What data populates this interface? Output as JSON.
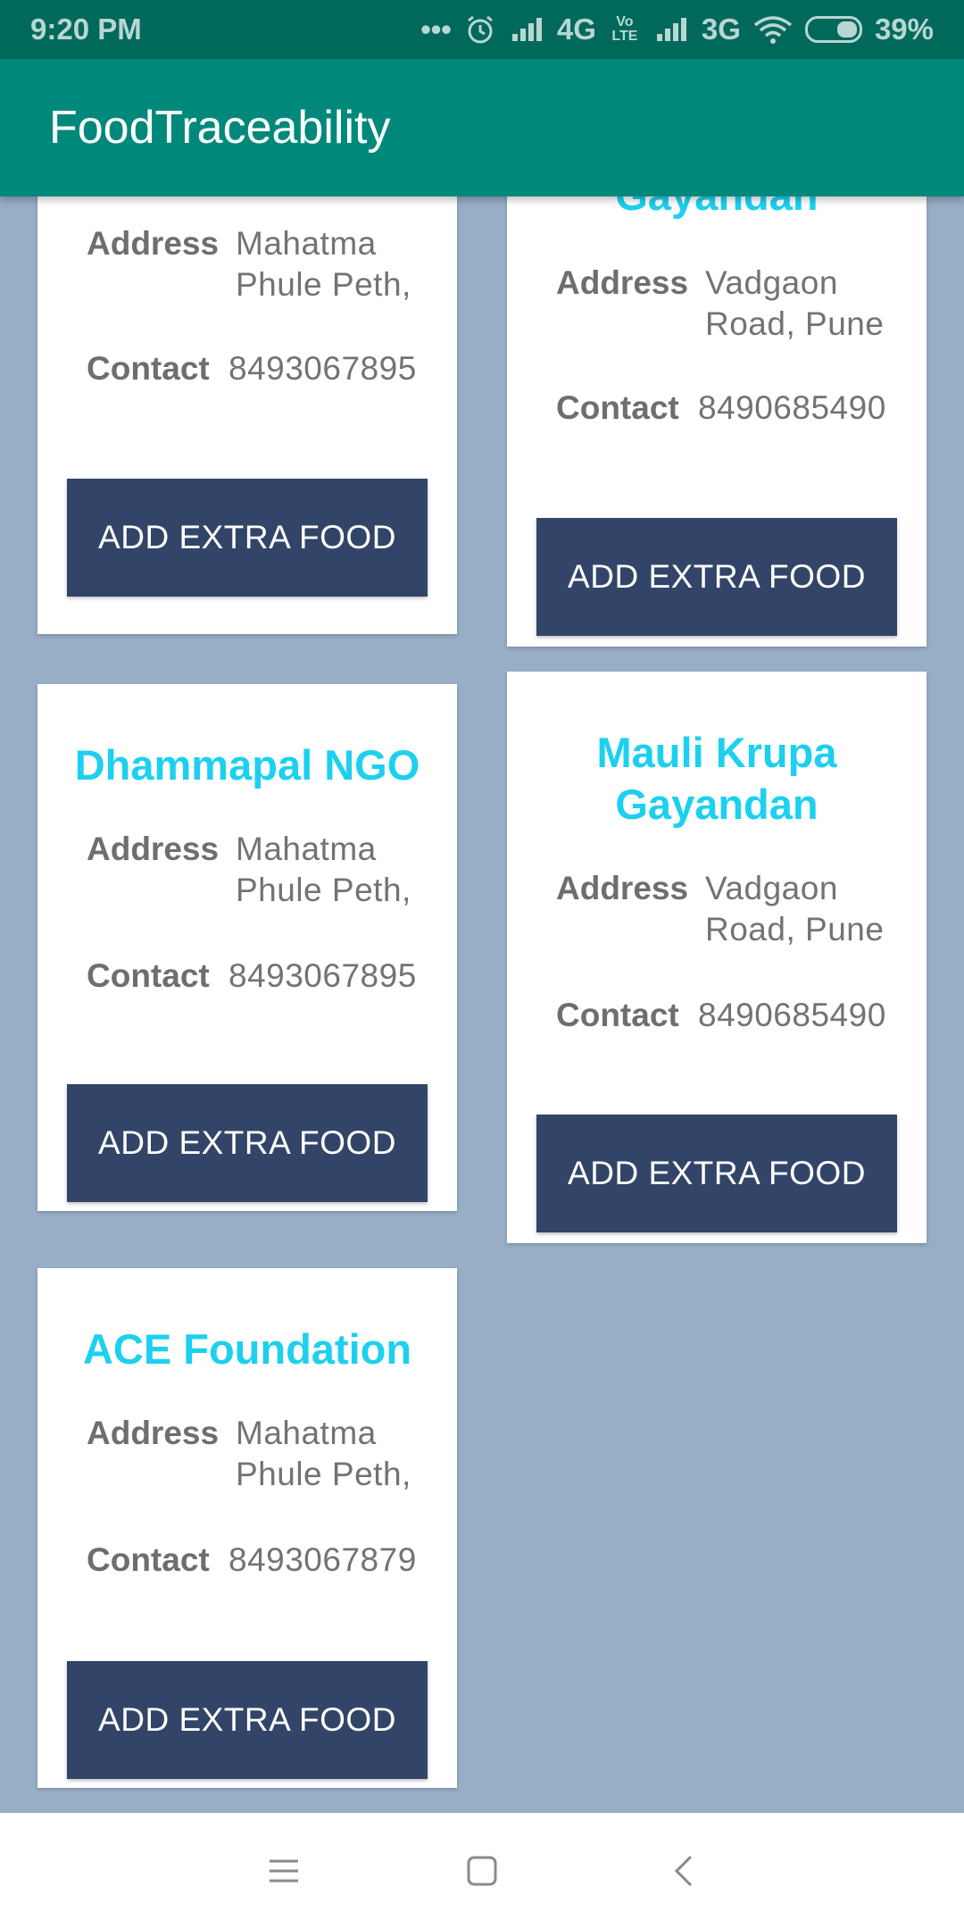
{
  "status": {
    "time": "9:20 PM",
    "dots": "•••",
    "network1": "4G",
    "volte": "Vo LTE",
    "network2": "3G",
    "battery": "39%"
  },
  "appbar": {
    "title": "FoodTraceability"
  },
  "cards": [
    {
      "title": "",
      "address_label": "Address",
      "address": "Mahatma Phule Peth,",
      "contact_label": "Contact",
      "contact": "8493067895",
      "button": "ADD EXTRA FOOD"
    },
    {
      "title": "Gayandan",
      "address_label": "Address",
      "address": "Vadgaon Road, Pune",
      "contact_label": "Contact",
      "contact": "8490685490",
      "button": "ADD EXTRA FOOD"
    },
    {
      "title": "Dhammapal NGO",
      "address_label": "Address",
      "address": "Mahatma Phule Peth,",
      "contact_label": "Contact",
      "contact": "8493067895",
      "button": "ADD EXTRA FOOD"
    },
    {
      "title": "Mauli Krupa Gayandan",
      "address_label": "Address",
      "address": "Vadgaon Road, Pune",
      "contact_label": "Contact",
      "contact": "8490685490",
      "button": "ADD EXTRA FOOD"
    },
    {
      "title": "ACE Foundation",
      "address_label": "Address",
      "address": "Mahatma Phule Peth,",
      "contact_label": "Contact",
      "contact": "8493067879",
      "button": "ADD EXTRA FOOD"
    }
  ],
  "colors": {
    "statusbar": "#00695c",
    "appbar": "#00897b",
    "background": "#98adc6",
    "title": "#1dd0ef",
    "button": "#324568"
  },
  "icons": {
    "status": [
      "alarm-icon",
      "signal-icon",
      "wifi-icon",
      "battery-icon"
    ],
    "nav": [
      "menu-icon",
      "home-icon",
      "back-icon"
    ]
  }
}
